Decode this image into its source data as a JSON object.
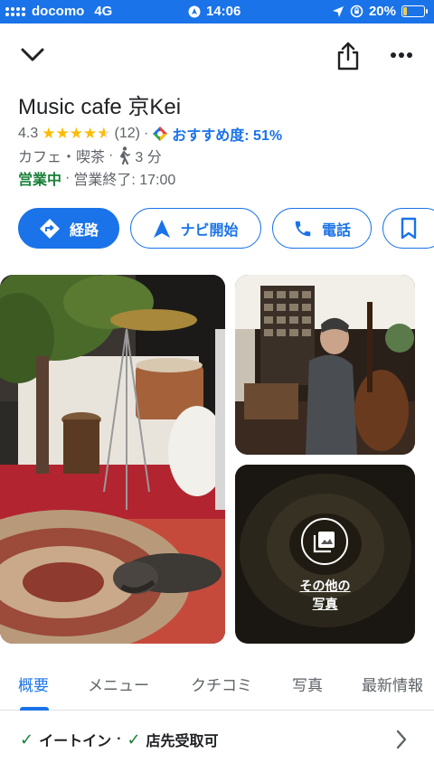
{
  "status_bar": {
    "carrier": "docomo",
    "network": "4G",
    "time": "14:06",
    "battery": "20%",
    "battery_level": 0.2
  },
  "header": {
    "back_icon": "chevron-down-icon",
    "share_icon": "share-icon",
    "more_icon": "more-horiz-icon"
  },
  "place": {
    "name": "Music cafe 京Kei",
    "rating": "4.3",
    "stars_value": 4.3,
    "review_count": "(12)",
    "separator": "·",
    "recommend": "おすすめ度: 51%",
    "category": "カフェ・喫茶",
    "walk_time": "3 分",
    "open_status": "営業中",
    "hours_text": "営業終了: 17:00"
  },
  "actions": [
    {
      "label": "経路",
      "icon": "directions-icon"
    },
    {
      "label": "ナビ開始",
      "icon": "navigation-icon"
    },
    {
      "label": "電話",
      "icon": "phone-icon"
    },
    {
      "label": "",
      "icon": "bookmark-icon"
    }
  ],
  "photos": {
    "more_label": "その他の\n写真"
  },
  "tabs": [
    "概要",
    "メニュー",
    "クチコミ",
    "写真",
    "最新情報"
  ],
  "features": {
    "item1": "イートイン",
    "dot": "·",
    "item2": "店先受取可"
  },
  "colors": {
    "accent": "#1a73e8",
    "open": "#188038",
    "star": "#fbbc04"
  }
}
